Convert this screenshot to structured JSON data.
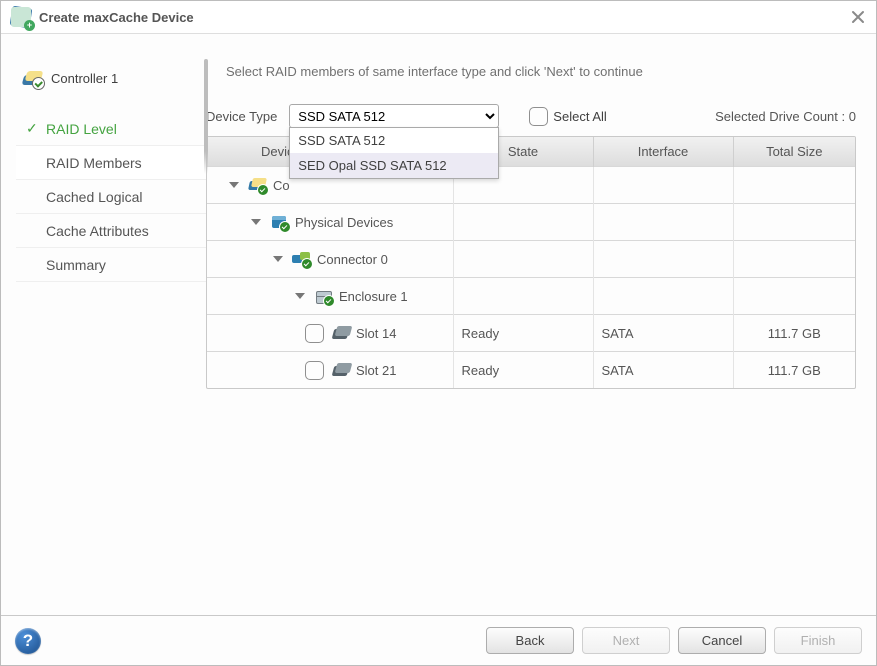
{
  "title": "Create maxCache Device",
  "sidebar": {
    "controller_label": "Controller 1",
    "steps": [
      {
        "label": "RAID Level",
        "done": true,
        "selected": false
      },
      {
        "label": "RAID Members",
        "done": false,
        "selected": true
      },
      {
        "label": "Cached Logical",
        "done": false,
        "selected": false
      },
      {
        "label": "Cache Attributes",
        "done": false,
        "selected": false
      },
      {
        "label": "Summary",
        "done": false,
        "selected": false
      }
    ]
  },
  "instruction": "Select RAID members of same interface type and click 'Next' to continue",
  "toolbar": {
    "device_type_label": "Device Type",
    "device_type_selected": "SSD SATA 512",
    "device_type_options": [
      "SSD SATA 512",
      "SED Opal SSD SATA 512"
    ],
    "dropdown_highlight_index": 1,
    "select_all_label": "Select All",
    "selected_drive_count_label": "Selected Drive Count :",
    "selected_drive_count": 0
  },
  "table": {
    "headers": [
      "Device",
      "State",
      "Interface",
      "Total Size"
    ],
    "rows": [
      {
        "kind": "controller",
        "label": "Co",
        "indent": 1
      },
      {
        "kind": "physical",
        "label": "Physical Devices",
        "indent": 2
      },
      {
        "kind": "connector",
        "label": "Connector 0",
        "indent": 3
      },
      {
        "kind": "enclosure",
        "label": "Enclosure 1",
        "indent": 4
      },
      {
        "kind": "drive",
        "label": "Slot 14",
        "indent": 5,
        "state": "Ready",
        "interface": "SATA",
        "size": "111.7 GB"
      },
      {
        "kind": "drive",
        "label": "Slot 21",
        "indent": 5,
        "state": "Ready",
        "interface": "SATA",
        "size": "111.7 GB"
      }
    ]
  },
  "footer": {
    "back": "Back",
    "next": "Next",
    "cancel": "Cancel",
    "finish": "Finish",
    "next_enabled": false,
    "finish_enabled": false
  }
}
